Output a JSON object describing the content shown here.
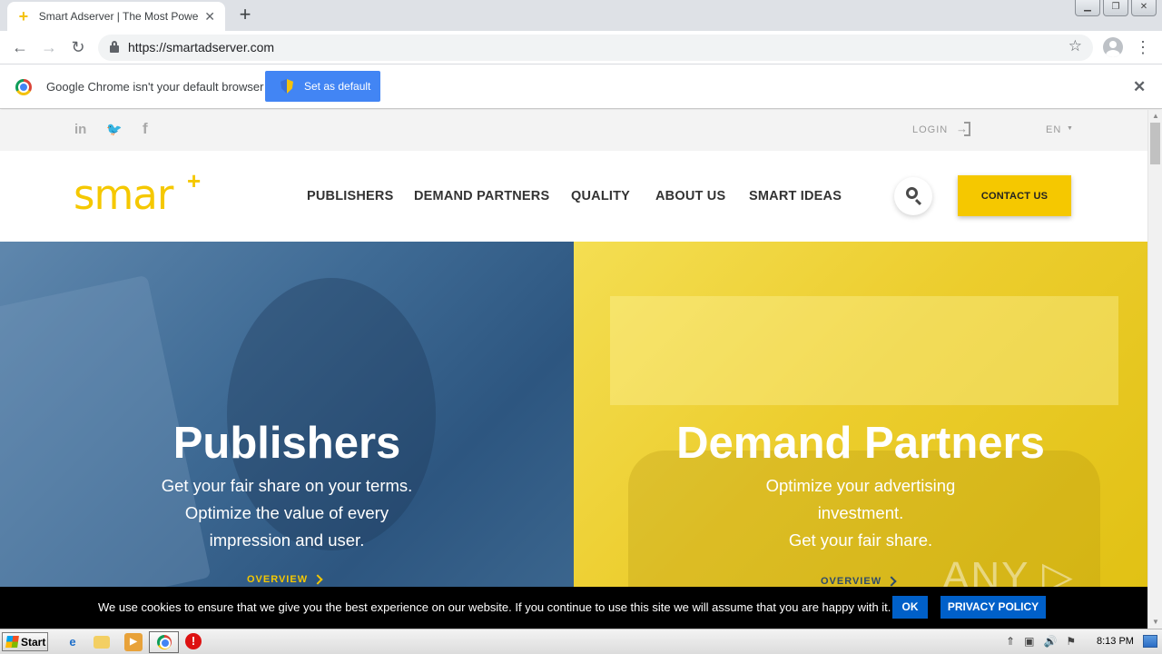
{
  "browser": {
    "tab_title": "Smart Adserver | The Most Powerful",
    "url": "https://smartadserver.com",
    "infobar_text": "Google Chrome isn't your default browser",
    "infobar_button": "Set as default",
    "icons": {
      "new_tab": "+",
      "tab_close": "✕",
      "back": "←",
      "forward": "→",
      "reload": "↻",
      "star": "☆",
      "menu": "⋮",
      "close": "✕"
    }
  },
  "site": {
    "brand_color": "#f5c800",
    "logo_text": "smar",
    "logo_plus": "+",
    "topbar": {
      "social": [
        "in",
        "🐦",
        "f"
      ],
      "login": "LOGIN",
      "language": "EN",
      "caret": "▼"
    },
    "nav": [
      "PUBLISHERS",
      "DEMAND PARTNERS",
      "QUALITY",
      "ABOUT US",
      "SMART IDEAS"
    ],
    "contact_button": "CONTACT US",
    "hero": {
      "left": {
        "title": "Publishers",
        "subtitle_lines": [
          "Get your fair share on your terms.",
          "Optimize the value of every",
          "impression and user."
        ],
        "link": "OVERVIEW",
        "color": "#3f6b95",
        "link_color": "#f5c800"
      },
      "right": {
        "title": "Demand Partners",
        "subtitle_lines": [
          "Optimize your advertising",
          "investment.",
          "Get your fair share."
        ],
        "link": "OVERVIEW",
        "color": "#eccd2d",
        "link_color": "#2d4a6b"
      }
    },
    "cookie": {
      "text": "We use cookies to ensure that we give you the best experience on our website. If you continue to use this site we will assume that you are happy with it.",
      "ok": "OK",
      "privacy": "PRIVACY POLICY"
    },
    "watermark": "ANY ▷ RUN"
  },
  "taskbar": {
    "start": "Start",
    "clock": "8:13 PM",
    "tray_icons": [
      "⇑",
      "▣",
      "🔊",
      "⚑"
    ]
  }
}
